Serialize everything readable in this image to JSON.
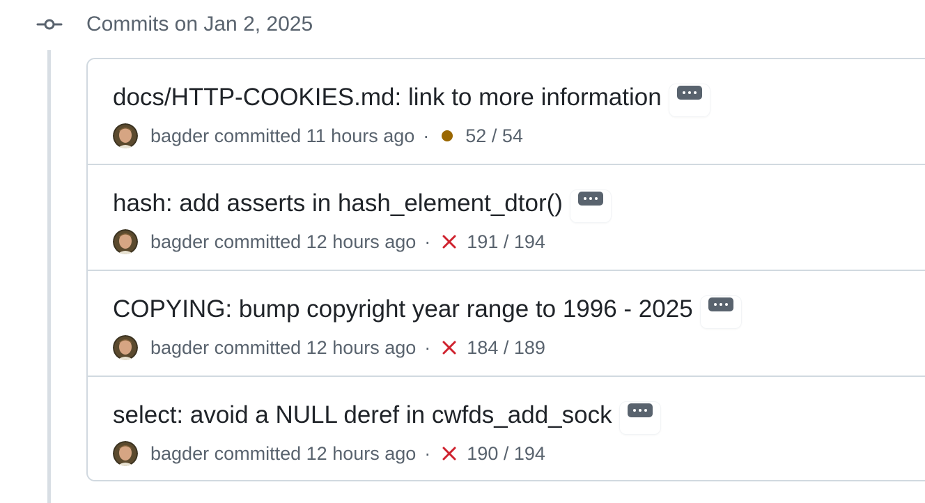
{
  "group": {
    "title": "Commits on Jan 2, 2025",
    "icon": "git-commit-icon"
  },
  "commits": [
    {
      "title": "docs/HTTP-COOKIES.md: link to more information",
      "author": "bagder",
      "action": "committed",
      "time": "11 hours ago",
      "separator": "·",
      "status": "pending",
      "status_icon": "pending-dot-icon",
      "status_color": "#9a6700",
      "checks": "52 / 54"
    },
    {
      "title": "hash: add asserts in hash_element_dtor()",
      "author": "bagder",
      "action": "committed",
      "time": "12 hours ago",
      "separator": "·",
      "status": "failed",
      "status_icon": "x-icon",
      "status_color": "#cf222e",
      "checks": "191 / 194"
    },
    {
      "title": "COPYING: bump copyright year range to 1996 - 2025",
      "author": "bagder",
      "action": "committed",
      "time": "12 hours ago",
      "separator": "·",
      "status": "failed",
      "status_icon": "x-icon",
      "status_color": "#cf222e",
      "checks": "184 / 189"
    },
    {
      "title": "select: avoid a NULL deref in cwfds_add_sock",
      "author": "bagder",
      "action": "committed",
      "time": "12 hours ago",
      "separator": "·",
      "status": "failed",
      "status_icon": "x-icon",
      "status_color": "#cf222e",
      "checks": "190 / 194"
    }
  ],
  "colors": {
    "muted_text": "#59636e",
    "primary_text": "#1f2328",
    "border": "#d1d9e0",
    "timeline": "#d8dee4"
  }
}
